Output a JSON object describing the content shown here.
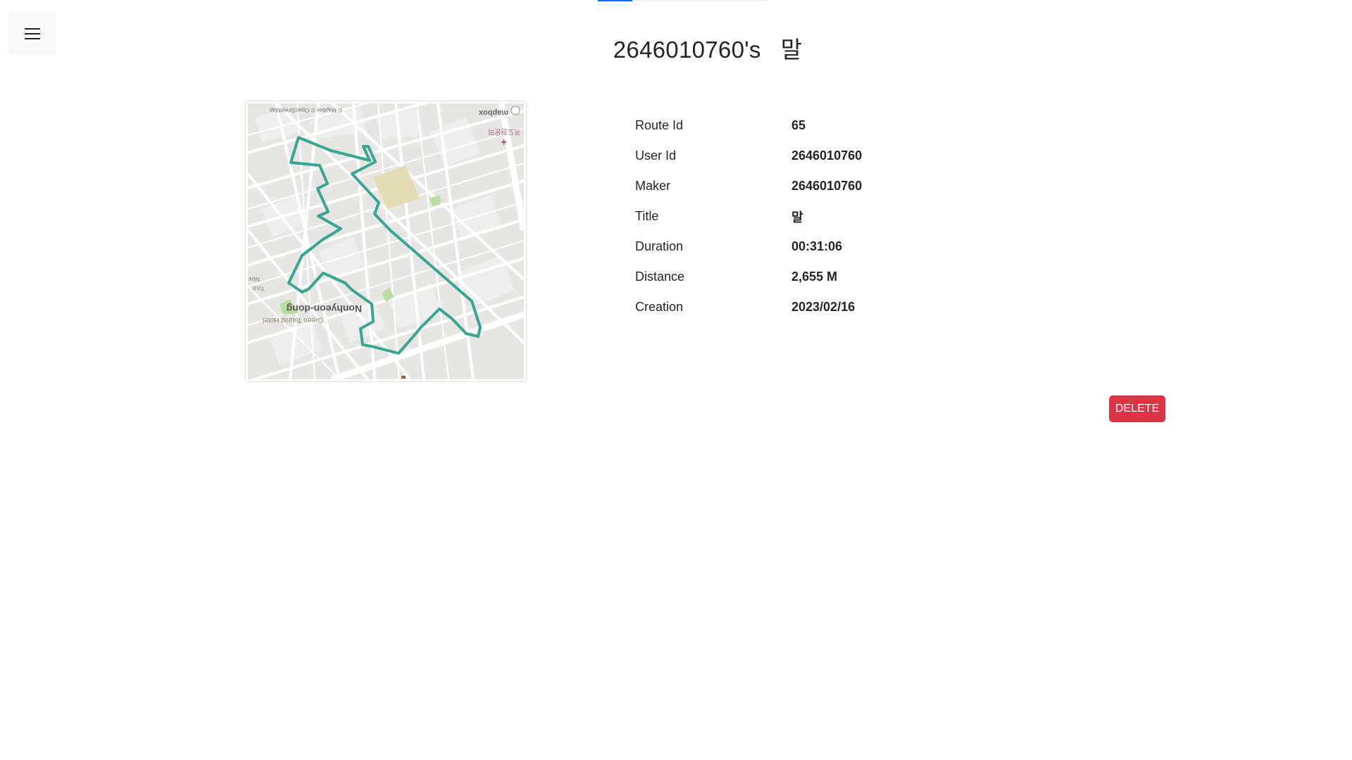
{
  "header": {
    "user_id": "2646010760's",
    "route_title": "말"
  },
  "menu": {
    "icon": "hamburger-menu-icon"
  },
  "map": {
    "place_label": "Nonhyeon-dong",
    "poi_label": "Green Tourist Hotel",
    "attribution": "© Mapbox © OpenStreetMap",
    "logo": "mapbox",
    "korean_label": "프도원운의",
    "edge_label_1": "Nov",
    "edge_label_2": "Tour",
    "route_color": "#3aa590"
  },
  "details": [
    {
      "label": "Route Id",
      "value": "65"
    },
    {
      "label": "User Id",
      "value": "2646010760"
    },
    {
      "label": "Maker",
      "value": "2646010760"
    },
    {
      "label": "Title",
      "value": "말"
    },
    {
      "label": "Duration",
      "value": "00:31:06"
    },
    {
      "label": "Distance",
      "value": "2,655 M"
    },
    {
      "label": "Creation",
      "value": "2023/02/16"
    }
  ],
  "actions": {
    "delete_label": "DELETE"
  },
  "colors": {
    "danger": "#dc3545",
    "accent": "#0d6efd"
  }
}
